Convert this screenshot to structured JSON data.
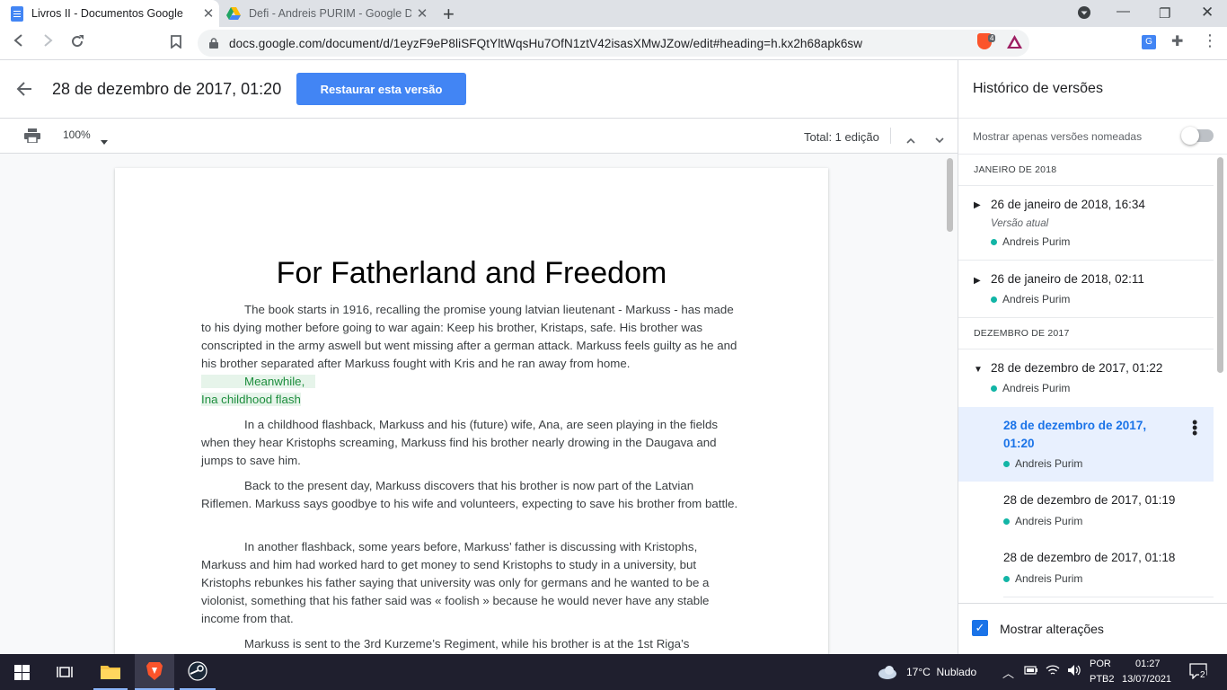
{
  "browser": {
    "tabs": [
      {
        "title": "Livros II - Documentos Google",
        "icon": "google-docs-icon"
      },
      {
        "title": "Defi - Andreis PURIM - Google Drive",
        "icon": "google-drive-icon"
      }
    ],
    "url": "docs.google.com/document/d/1eyzF9eP8liSFQtYltWqsHu7OfN1ztV42isasXMwJZow/edit#heading=h.kx2h68apk6sw",
    "brave_badge": "4"
  },
  "header": {
    "version_title": "28 de dezembro de 2017, 01:20",
    "restore_label": "Restaurar esta versão",
    "zoom": "100%",
    "total_edits": "Total: 1 edição"
  },
  "document": {
    "title": "For Fatherland and Freedom",
    "p1": "The book starts in 1916, recalling the promise young latvian lieutenant - Markuss - has made to his dying mother before going to war again: Keep his brother, Kristaps, safe. His brother was conscripted in the army aswell but went missing after a german attack. Markuss feels guilty as he and his brother separated after Markuss fought with Kris and he ran away from home.",
    "p2a": "Meanwhile,",
    "p2b": "Ina childhood flash",
    "p3": "In a childhood flashback, Markuss and his (future) wife, Ana, are seen playing in the fields when they hear Kristophs screaming, Markuss find his brother nearly drowing in the Daugava and jumps to save him.",
    "p4": "Back to the present day, Markuss discovers that his brother is now part of the Latvian Riflemen. Markuss says goodbye to his wife and volunteers, expecting to save his brother from battle.",
    "p5": "In another flashback, some years before, Markuss’ father is discussing with Kristophs, Markuss and him had worked hard to get money to send Kristophs to study in a university, but Kristophs rebunkes his father saying that university was only for germans and he wanted to be a violonist, something that his father said was « foolish » because he would never have any stable income from that.",
    "p6": "Markuss is sent to the 3rd Kurzeme’s Regiment, while his brother is at the 1st Riga’s"
  },
  "sidebar": {
    "title": "Histórico de versões",
    "only_named": "Mostrar apenas versões nomeadas",
    "month1": "JANEIRO DE 2018",
    "month2": "DEZEMBRO DE 2017",
    "versions": [
      {
        "time": "26 de janeiro de 2018, 16:34",
        "note": "Versão atual",
        "author": "Andreis Purim"
      },
      {
        "time": "26 de janeiro de 2018, 02:11",
        "author": "Andreis Purim"
      },
      {
        "time": "28 de dezembro de 2017, 01:22",
        "author": "Andreis Purim"
      },
      {
        "time_line1": "28 de dezembro de 2017,",
        "time_line2": "01:20",
        "author": "Andreis Purim"
      },
      {
        "time": "28 de dezembro de 2017, 01:19",
        "author": "Andreis Purim"
      },
      {
        "time": "28 de dezembro de 2017, 01:18",
        "author": "Andreis Purim"
      }
    ],
    "show_changes": "Mostrar alterações"
  },
  "taskbar": {
    "weather": "17°C  Nublado",
    "lang1": "POR",
    "lang2": "PTB2",
    "time": "01:27",
    "date": "13/07/2021",
    "notifications": "2"
  }
}
